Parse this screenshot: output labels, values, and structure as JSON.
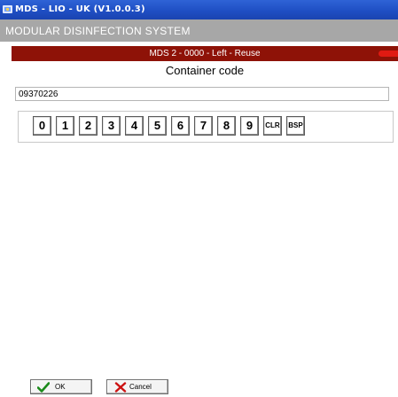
{
  "window": {
    "title": "MDS - LIO - UK  (V1.0.0.3)"
  },
  "banner": {
    "system_name": "MODULAR DISINFECTION SYSTEM"
  },
  "status": {
    "mode": "MDS 2 - 0000 - Left - Reuse"
  },
  "form": {
    "heading": "Container code",
    "code_value": "09370226"
  },
  "keypad": {
    "keys": [
      "0",
      "1",
      "2",
      "3",
      "4",
      "5",
      "6",
      "7",
      "8",
      "9",
      "CLR",
      "BSP"
    ]
  },
  "buttons": {
    "ok_label": "OK",
    "cancel_label": "Cancel"
  },
  "colors": {
    "titlebar": "#1f4fc4",
    "banner": "#a7a7a7",
    "status_bar": "#8e1207",
    "status_indicator": "#e01a12",
    "ok_check": "#1a8a1a",
    "cancel_x": "#cc1111"
  },
  "icons": {
    "app": "app-icon",
    "ok": "checkmark-icon",
    "cancel": "x-mark-icon"
  }
}
